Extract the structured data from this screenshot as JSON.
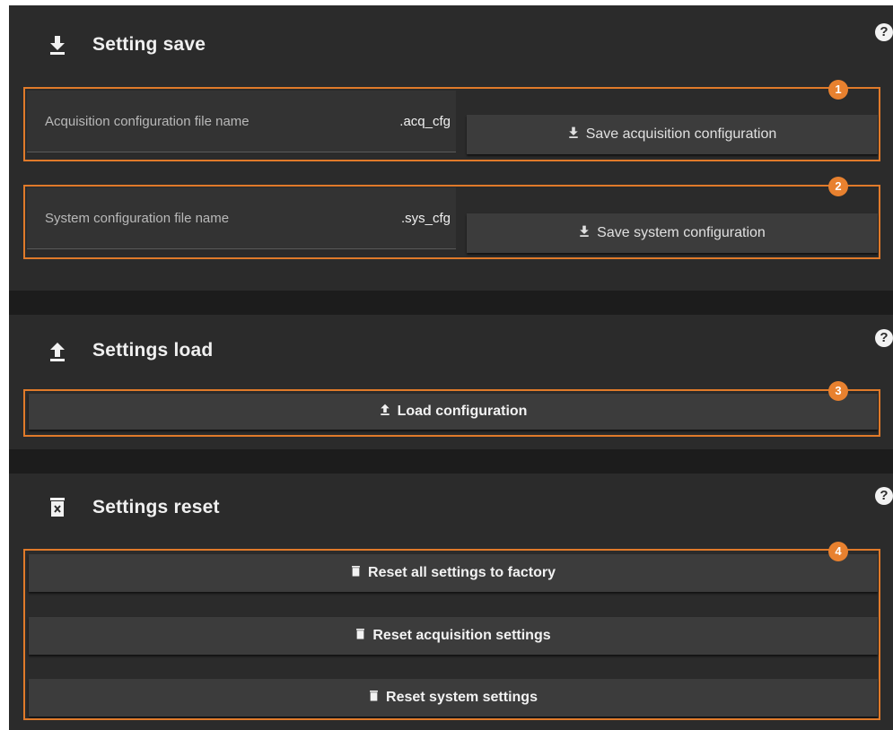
{
  "save": {
    "title": "Setting save",
    "acq_label": "Acquisition configuration file name",
    "acq_ext": ".acq_cfg",
    "acq_button": "Save acquisition configuration",
    "sys_label": "System configuration file name",
    "sys_ext": ".sys_cfg",
    "sys_button": "Save system configuration",
    "help": "?"
  },
  "load": {
    "title": "Settings load",
    "button": "Load configuration",
    "help": "?"
  },
  "reset": {
    "title": "Settings reset",
    "factory_button": "Reset all settings to factory",
    "acq_button": "Reset acquisition settings",
    "sys_button": "Reset system settings",
    "help": "?"
  },
  "callouts": [
    "1",
    "2",
    "3",
    "4"
  ],
  "colors": {
    "accent": "#e07a2a",
    "panel": "#2b2b2b",
    "background": "#1c1c1c"
  }
}
